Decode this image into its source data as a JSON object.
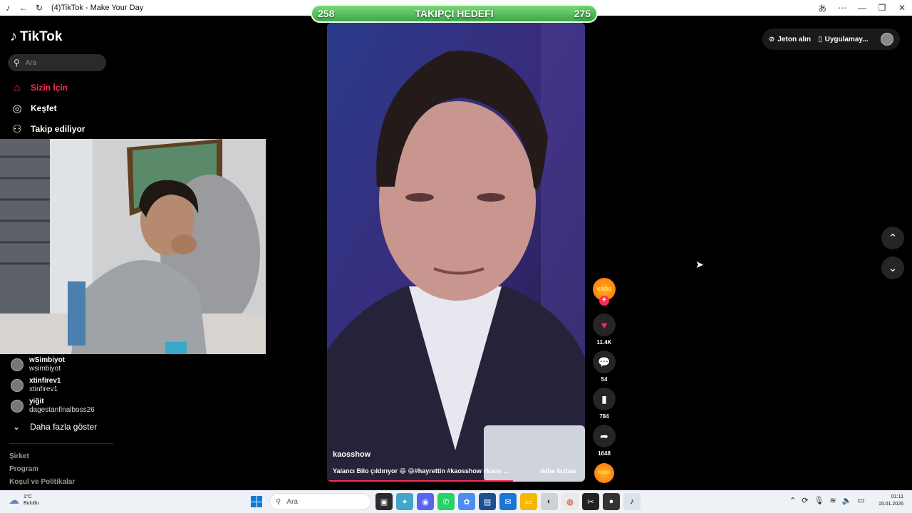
{
  "browser": {
    "title": "(4)TikTok - Make Your Day"
  },
  "goal_overlay": {
    "label": "TAKIPÇI HEDEFI",
    "current": "258",
    "target": "275",
    "progress_fraction": 0.938
  },
  "sidebar": {
    "logo": "TikTok",
    "search_placeholder": "Ara",
    "nav": [
      {
        "label": "Sizin İçin",
        "icon": "home-icon",
        "active": true
      },
      {
        "label": "Keşfet",
        "icon": "compass-icon",
        "active": false
      },
      {
        "label": "Takip ediliyor",
        "icon": "following-icon",
        "active": false
      }
    ],
    "following": [
      {
        "name": "wSimbiyot",
        "username": "wsimbiyot"
      },
      {
        "name": "xtinfirev1",
        "username": "xtinfirev1"
      },
      {
        "name": "yiğit",
        "username": "dagestanfinalboss26"
      }
    ],
    "show_more": "Daha fazla göster",
    "footer_links": [
      "Şirket",
      "Program",
      "Koşul ve Politikalar"
    ]
  },
  "video": {
    "username": "kaosshow",
    "description": "Yalancı Bilo çıldırıyor 😆 😆#hayrettin #kaosshow #kaos ...",
    "see_more": "daha fazlası",
    "progress_fraction": 0.72
  },
  "actions": {
    "creator_avatar_text": "KAOS",
    "likes": "11.4K",
    "comments": "54",
    "saves": "784",
    "shares": "1648"
  },
  "top_right": {
    "coins": "Jeton alın",
    "app": "Uygulamay..."
  },
  "taskbar": {
    "temp": "1°C",
    "weather": "Bulutlu",
    "search_placeholder": "Ara",
    "time": "01:11",
    "date": "15.01.2026"
  },
  "colors": {
    "accent": "#fe2c55",
    "goal_green": "#2f9f3a"
  }
}
